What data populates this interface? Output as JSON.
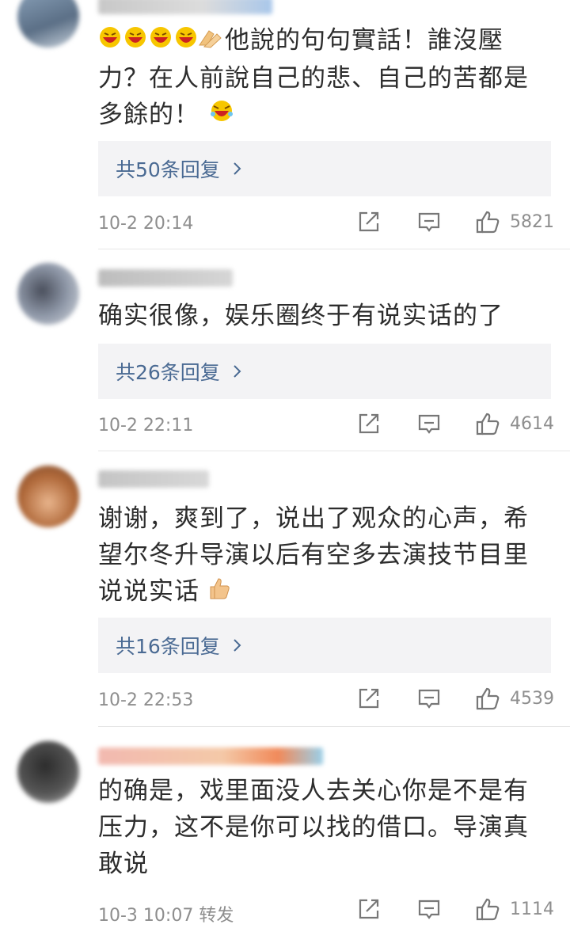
{
  "comments": [
    {
      "text_line1": "他說的句句實話！誰沒壓",
      "text_line2": "力？在人前說自己的悲、自己的苦都是",
      "text_line3": "多餘的！",
      "replies": "共50条回复",
      "time": "10-2 20:14",
      "likes": "5821"
    },
    {
      "text_line1": "确实很像，娱乐圈终于有说实话的了",
      "replies": "共26条回复",
      "time": "10-2 22:11",
      "likes": "4614"
    },
    {
      "text_line1": "谢谢，爽到了，说出了观众的心声，希",
      "text_line2": "望尔冬升导演以后有空多去演技节目里",
      "text_line3": "说说实话",
      "replies": "共16条回复",
      "time": "10-2 22:53",
      "likes": "4539"
    },
    {
      "text_line1": "的确是，戏里面没人去关心你是不是有",
      "text_line2": "压力，这不是你可以找的借口。导演真",
      "text_line3": "敢说",
      "time": "10-3 10:07",
      "forward": "转发",
      "likes": "1114"
    }
  ],
  "colors": {
    "link": "#4a6a93",
    "meta": "#8e8e8e",
    "reply_bg": "#f3f3f5"
  },
  "icons": [
    "share-icon",
    "comment-icon",
    "like-icon",
    "chevron-right-icon",
    "laughing-emoji-icon",
    "clap-emoji-icon",
    "thumbs-up-emoji-icon"
  ]
}
